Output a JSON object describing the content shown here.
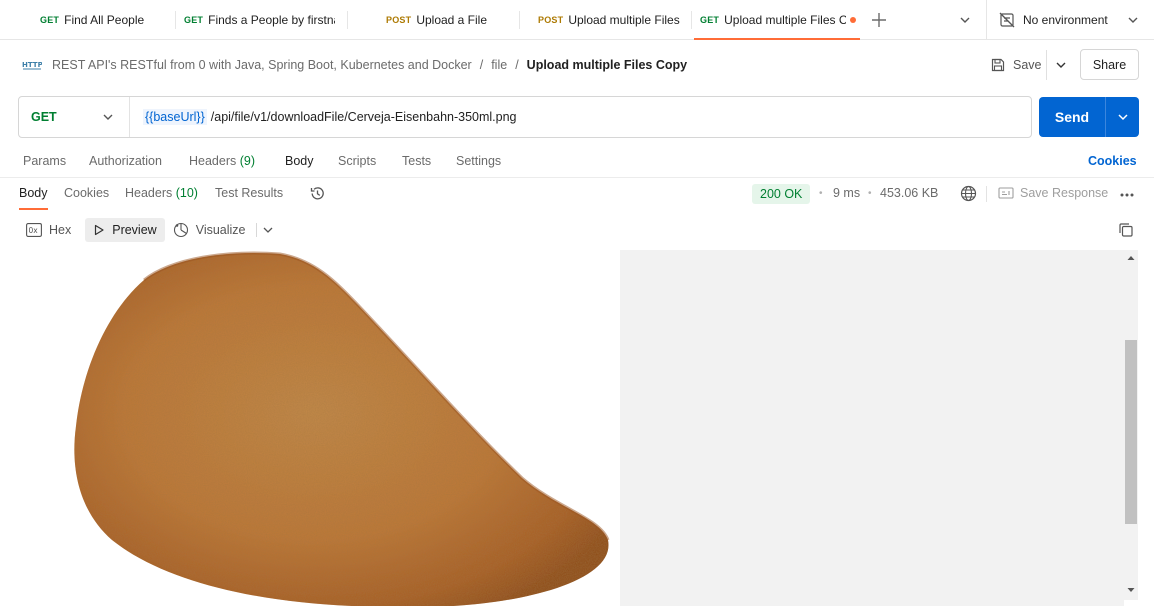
{
  "tabs": [
    {
      "method": "GET",
      "label": "Find All People"
    },
    {
      "method": "GET",
      "label": "Finds a People by firstna"
    },
    {
      "method": "POST",
      "label": "Upload a File"
    },
    {
      "method": "POST",
      "label": "Upload multiple Files"
    },
    {
      "method": "GET",
      "label": "Upload multiple Files Co"
    }
  ],
  "environment": {
    "label": "No environment"
  },
  "breadcrumb": {
    "collection": "REST API's RESTful from 0 with Java, Spring Boot, Kubernetes and Docker",
    "folder": "file",
    "separator": "/",
    "current": "Upload multiple Files Copy"
  },
  "toolbar": {
    "save_label": "Save",
    "share_label": "Share"
  },
  "request": {
    "method": "GET",
    "url_variable": "{{baseUrl}}",
    "url_path": "/api/file/v1/downloadFile/Cerveja-Eisenbahn-350ml.png",
    "send_label": "Send"
  },
  "request_tabs": {
    "params": "Params",
    "authorization": "Authorization",
    "headers": "Headers",
    "headers_count": "(9)",
    "body": "Body",
    "scripts": "Scripts",
    "tests": "Tests",
    "settings": "Settings",
    "cookies": "Cookies"
  },
  "response_tabs": {
    "body": "Body",
    "cookies": "Cookies",
    "headers": "Headers",
    "headers_count": "(10)",
    "test_results": "Test Results"
  },
  "response_meta": {
    "status": "200 OK",
    "time": "9 ms",
    "size": "453.06 KB",
    "save_response": "Save Response",
    "dot": "•"
  },
  "response_toolbar": {
    "hex": "Hex",
    "preview": "Preview",
    "visualize": "Visualize"
  },
  "colors": {
    "accent": "#ff6c37",
    "send_blue": "#0265d2",
    "get_green": "#007f31",
    "post_amber": "#ad7a03",
    "pastel_crust": "#c17c3a"
  },
  "icons": [
    "plus-icon",
    "chevron-down-icon",
    "no-environment-icon",
    "http-icon",
    "save-icon",
    "history-icon",
    "globe-icon",
    "save-response-icon",
    "more-icon",
    "hex-icon",
    "play-icon",
    "visualize-icon",
    "copy-icon"
  ]
}
